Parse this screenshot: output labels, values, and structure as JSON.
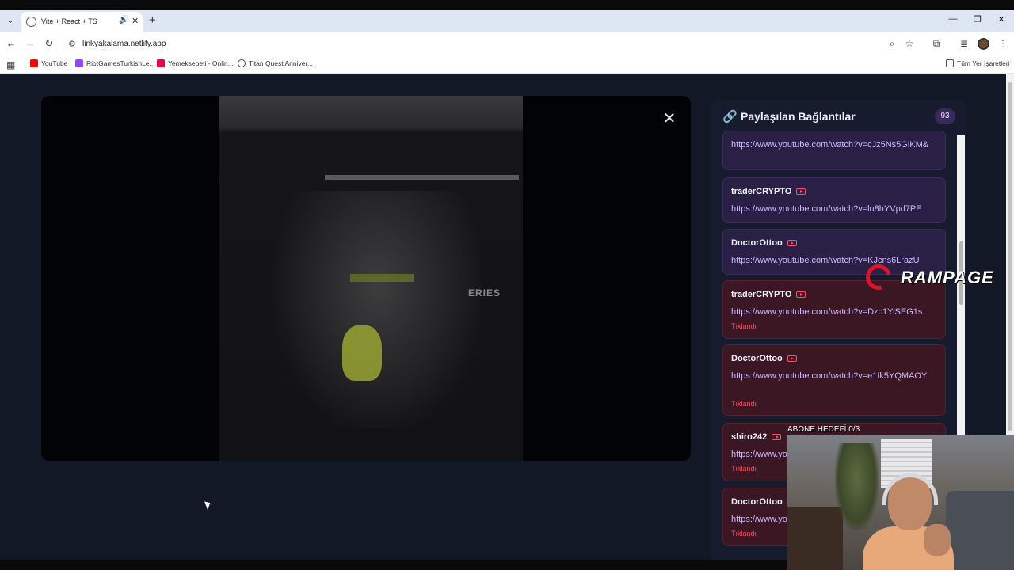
{
  "browser": {
    "tab_title": "Vite + React + TS",
    "url": "linkyakalama.netlify.app",
    "bookmarks": [
      {
        "label": "YouTube",
        "color": "#ff0000"
      },
      {
        "label": "RiotGamesTurkishLe...",
        "color": "#9146ff"
      },
      {
        "label": "Yemeksepeti - Onlin...",
        "color": "#ea004b"
      },
      {
        "label": "Titan Quest Anniver...",
        "color": "#555555"
      }
    ],
    "all_bookmarks_label": "Tüm Yer İşaretleri"
  },
  "video": {
    "overlay_text": "ERIES"
  },
  "panel": {
    "title": "Paylaşılan Bağlantılar",
    "count": "93",
    "items": [
      {
        "user": "",
        "link": "https://www.youtube.com/watch?v=cJz5Ns5GlKM&",
        "clicked": ""
      },
      {
        "user": "traderCRYPTO",
        "link": "https://www.youtube.com/watch?v=lu8hYVpd7PE",
        "clicked": ""
      },
      {
        "user": "DoctorOttoo",
        "link": "https://www.youtube.com/watch?v=KJcns6LrazU",
        "clicked": ""
      },
      {
        "user": "traderCRYPTO",
        "link": "https://www.youtube.com/watch?v=Dzc1YiSEG1s",
        "clicked": "Tıklandı"
      },
      {
        "user": "DoctorOttoo",
        "link": "https://www.youtube.com/watch?v=e1fk5YQMAOY",
        "clicked": "Tıklandı"
      },
      {
        "user": "shiro242",
        "link": "https://www.youtube.com/watch?v=",
        "clicked": "Tıklandı"
      },
      {
        "user": "DoctorOttoo",
        "link": "https://www.youtube.com/watch?v=",
        "clicked": "Tıklandı"
      }
    ]
  },
  "overlay": {
    "logo_text": "RAMPAGE",
    "goal_text": "ABONE HEDEFİ  0/3"
  },
  "colors": {
    "page_bg": "#121826",
    "panel_bg": "#161b2e",
    "accent_purple": "#b392f0",
    "clicked_red": "#ff4d5e"
  }
}
